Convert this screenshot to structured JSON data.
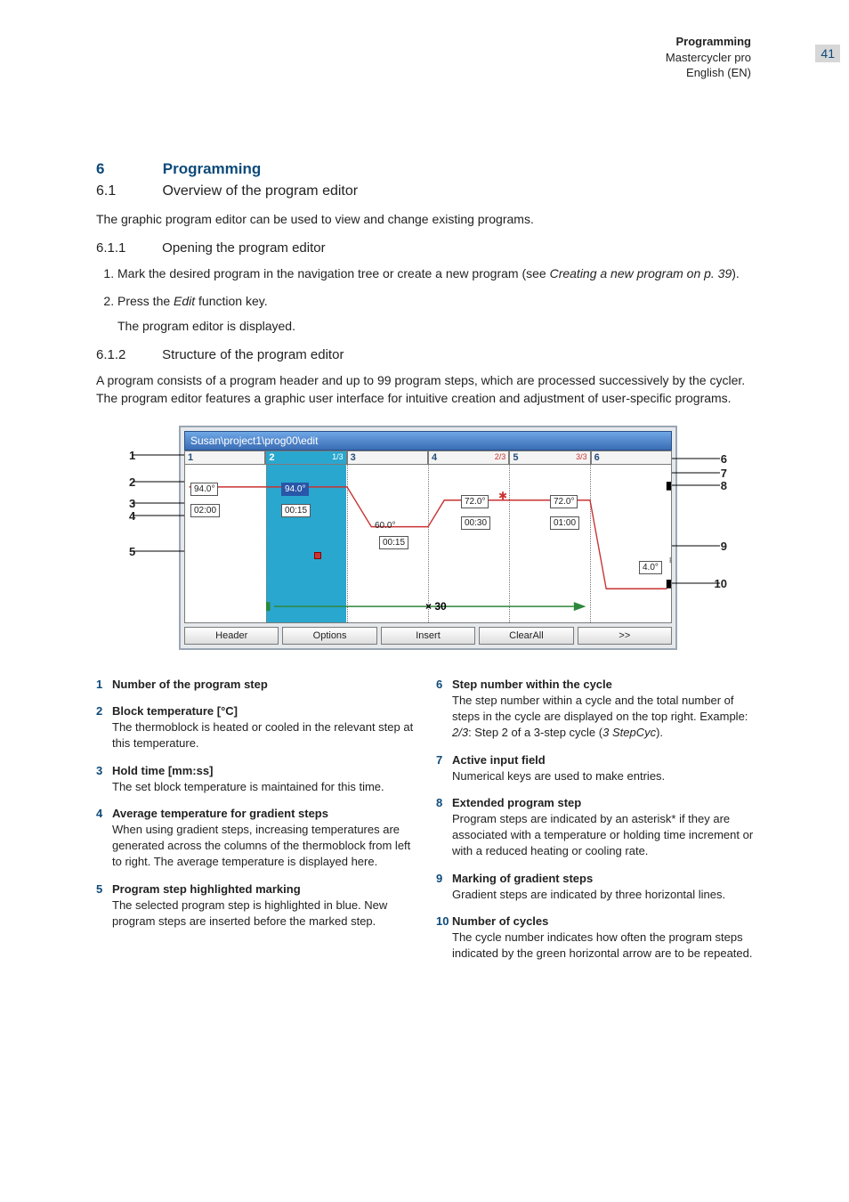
{
  "header": {
    "section": "Programming",
    "product": "Mastercycler pro",
    "lang": "English (EN)",
    "page": "41"
  },
  "h1_num": "6",
  "h1_txt": "Programming",
  "s61_num": "6.1",
  "s61_txt": "Overview of the program editor",
  "p_intro": "The graphic program editor can be used to view and change existing programs.",
  "s611_num": "6.1.1",
  "s611_txt": "Opening the program editor",
  "step1_pre": "Mark the desired program in the navigation tree or create a new program (see ",
  "step1_it": "Creating a new program on p. 39",
  "step1_post": ").",
  "step2_pre": "Press the ",
  "step2_it": "Edit",
  "step2_post": " function key.",
  "step2_out": "The program editor is displayed.",
  "s612_num": "6.1.2",
  "s612_txt": "Structure of the program editor",
  "p612": "A program consists of a program header and up to 99 program steps, which are processed successively by the cycler. The program editor features a graphic user interface for intuitive creation and adjustment of user-specific programs.",
  "diagram": {
    "titlebar": "Susan\\project1\\prog00\\edit",
    "steps": [
      "1",
      "2",
      "3",
      "4",
      "5",
      "6"
    ],
    "frac2": "1/3",
    "frac4": "2/3",
    "frac5": "3/3",
    "t1": "94.0°",
    "t2": "94.0°",
    "t3": "60.0°",
    "t4": "72.0°",
    "t5": "72.0°",
    "t6": "4.0°",
    "h1": "02:00",
    "h2": "00:15",
    "h3": "00:15",
    "h4": "00:30",
    "h5": "01:00",
    "cycles": "× 30",
    "btn_header": "Header",
    "btn_options": "Options",
    "btn_insert": "Insert",
    "btn_clear": "ClearAll",
    "btn_more": ">>"
  },
  "callouts_left": [
    "1",
    "2",
    "3",
    "4",
    "5"
  ],
  "callouts_right": [
    "6",
    "7",
    "8",
    "9",
    "10"
  ],
  "legend": {
    "l1_t": "Number of the program step",
    "l2_t": "Block temperature [°C]",
    "l2_d": "The thermoblock is heated or cooled in the relevant step at this temperature.",
    "l3_t": "Hold time [mm:ss]",
    "l3_d": "The set block temperature is maintained for this time.",
    "l4_t": "Average temperature for gradient steps",
    "l4_d": "When using gradient steps, increasing temperatures are generated across the columns of the thermoblock from left to right. The average temperature is displayed here.",
    "l5_t": "Program step highlighted marking",
    "l5_d": "The selected program step is highlighted in blue. New program steps are inserted before the marked step.",
    "r6_t": "Step number within the cycle",
    "r6_d_a": "The step number within a cycle and the total number of steps in the cycle are displayed on the top right. Example: ",
    "r6_it1": "2/3",
    "r6_d_b": ": Step 2 of a 3-step cycle (",
    "r6_it2": "3 StepCyc",
    "r6_d_c": ").",
    "r7_t": "Active input field",
    "r7_d": "Numerical keys are used to make entries.",
    "r8_t": "Extended program step",
    "r8_d": "Program steps are indicated by an asterisk* if they are associated with a temperature or holding time increment or with a reduced heating or cooling rate.",
    "r9_t": "Marking of gradient steps",
    "r9_d": "Gradient steps are indicated by three horizontal lines.",
    "r10_t": "Number of cycles",
    "r10_d": "The cycle number indicates how often the program steps indicated by the green horizontal arrow are to be repeated."
  }
}
